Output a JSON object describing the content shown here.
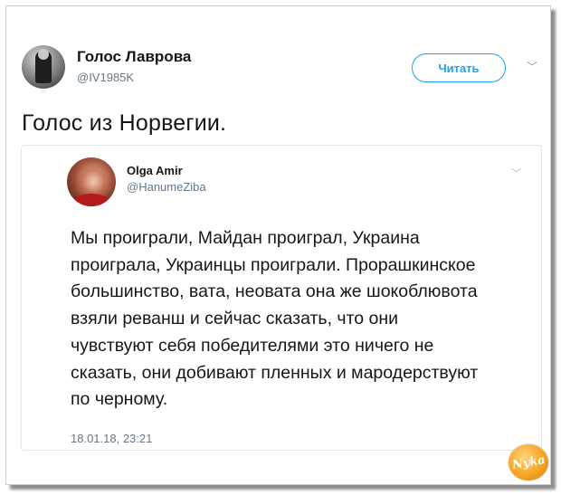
{
  "author": {
    "display_name": "Голос Лаврова",
    "handle": "@IV1985K",
    "avatar_icon": "user-avatar-photo"
  },
  "follow_button": {
    "label": "Читать",
    "color": "#1da1f2"
  },
  "menu_caret": "﹀",
  "tweet": {
    "text": "Голос из Норвегии."
  },
  "quoted": {
    "display_name": "Olga Amir",
    "handle": "@HanumeZiba",
    "caret": "﹀",
    "body_lines": [
      "Мы проиграли, Майдан проиграл, Украина",
      "проиграла, Украинцы проиграли. Прорашкинское",
      "большинство, вата, неовата она же шокоблювота",
      "взяли реванш и сейчас сказать, что они",
      "чувствуют себя победителями это ничего не",
      "сказать, они добивают пленных и мародерствуют",
      "по черному."
    ],
    "timestamp": "18.01.18, 23:21"
  },
  "watermark": {
    "text": "Nyka",
    "color": "#f5a623"
  }
}
